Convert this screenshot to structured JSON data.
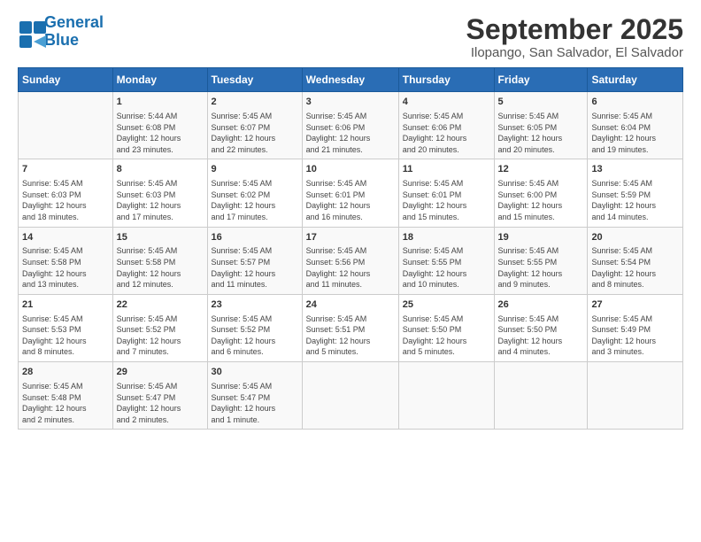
{
  "logo": {
    "line1": "General",
    "line2": "Blue"
  },
  "title": "September 2025",
  "subtitle": "Ilopango, San Salvador, El Salvador",
  "weekdays": [
    "Sunday",
    "Monday",
    "Tuesday",
    "Wednesday",
    "Thursday",
    "Friday",
    "Saturday"
  ],
  "weeks": [
    [
      {
        "day": "",
        "info": ""
      },
      {
        "day": "1",
        "info": "Sunrise: 5:44 AM\nSunset: 6:08 PM\nDaylight: 12 hours\nand 23 minutes."
      },
      {
        "day": "2",
        "info": "Sunrise: 5:45 AM\nSunset: 6:07 PM\nDaylight: 12 hours\nand 22 minutes."
      },
      {
        "day": "3",
        "info": "Sunrise: 5:45 AM\nSunset: 6:06 PM\nDaylight: 12 hours\nand 21 minutes."
      },
      {
        "day": "4",
        "info": "Sunrise: 5:45 AM\nSunset: 6:06 PM\nDaylight: 12 hours\nand 20 minutes."
      },
      {
        "day": "5",
        "info": "Sunrise: 5:45 AM\nSunset: 6:05 PM\nDaylight: 12 hours\nand 20 minutes."
      },
      {
        "day": "6",
        "info": "Sunrise: 5:45 AM\nSunset: 6:04 PM\nDaylight: 12 hours\nand 19 minutes."
      }
    ],
    [
      {
        "day": "7",
        "info": "Sunrise: 5:45 AM\nSunset: 6:03 PM\nDaylight: 12 hours\nand 18 minutes."
      },
      {
        "day": "8",
        "info": "Sunrise: 5:45 AM\nSunset: 6:03 PM\nDaylight: 12 hours\nand 17 minutes."
      },
      {
        "day": "9",
        "info": "Sunrise: 5:45 AM\nSunset: 6:02 PM\nDaylight: 12 hours\nand 17 minutes."
      },
      {
        "day": "10",
        "info": "Sunrise: 5:45 AM\nSunset: 6:01 PM\nDaylight: 12 hours\nand 16 minutes."
      },
      {
        "day": "11",
        "info": "Sunrise: 5:45 AM\nSunset: 6:01 PM\nDaylight: 12 hours\nand 15 minutes."
      },
      {
        "day": "12",
        "info": "Sunrise: 5:45 AM\nSunset: 6:00 PM\nDaylight: 12 hours\nand 15 minutes."
      },
      {
        "day": "13",
        "info": "Sunrise: 5:45 AM\nSunset: 5:59 PM\nDaylight: 12 hours\nand 14 minutes."
      }
    ],
    [
      {
        "day": "14",
        "info": "Sunrise: 5:45 AM\nSunset: 5:58 PM\nDaylight: 12 hours\nand 13 minutes."
      },
      {
        "day": "15",
        "info": "Sunrise: 5:45 AM\nSunset: 5:58 PM\nDaylight: 12 hours\nand 12 minutes."
      },
      {
        "day": "16",
        "info": "Sunrise: 5:45 AM\nSunset: 5:57 PM\nDaylight: 12 hours\nand 11 minutes."
      },
      {
        "day": "17",
        "info": "Sunrise: 5:45 AM\nSunset: 5:56 PM\nDaylight: 12 hours\nand 11 minutes."
      },
      {
        "day": "18",
        "info": "Sunrise: 5:45 AM\nSunset: 5:55 PM\nDaylight: 12 hours\nand 10 minutes."
      },
      {
        "day": "19",
        "info": "Sunrise: 5:45 AM\nSunset: 5:55 PM\nDaylight: 12 hours\nand 9 minutes."
      },
      {
        "day": "20",
        "info": "Sunrise: 5:45 AM\nSunset: 5:54 PM\nDaylight: 12 hours\nand 8 minutes."
      }
    ],
    [
      {
        "day": "21",
        "info": "Sunrise: 5:45 AM\nSunset: 5:53 PM\nDaylight: 12 hours\nand 8 minutes."
      },
      {
        "day": "22",
        "info": "Sunrise: 5:45 AM\nSunset: 5:52 PM\nDaylight: 12 hours\nand 7 minutes."
      },
      {
        "day": "23",
        "info": "Sunrise: 5:45 AM\nSunset: 5:52 PM\nDaylight: 12 hours\nand 6 minutes."
      },
      {
        "day": "24",
        "info": "Sunrise: 5:45 AM\nSunset: 5:51 PM\nDaylight: 12 hours\nand 5 minutes."
      },
      {
        "day": "25",
        "info": "Sunrise: 5:45 AM\nSunset: 5:50 PM\nDaylight: 12 hours\nand 5 minutes."
      },
      {
        "day": "26",
        "info": "Sunrise: 5:45 AM\nSunset: 5:50 PM\nDaylight: 12 hours\nand 4 minutes."
      },
      {
        "day": "27",
        "info": "Sunrise: 5:45 AM\nSunset: 5:49 PM\nDaylight: 12 hours\nand 3 minutes."
      }
    ],
    [
      {
        "day": "28",
        "info": "Sunrise: 5:45 AM\nSunset: 5:48 PM\nDaylight: 12 hours\nand 2 minutes."
      },
      {
        "day": "29",
        "info": "Sunrise: 5:45 AM\nSunset: 5:47 PM\nDaylight: 12 hours\nand 2 minutes."
      },
      {
        "day": "30",
        "info": "Sunrise: 5:45 AM\nSunset: 5:47 PM\nDaylight: 12 hours\nand 1 minute."
      },
      {
        "day": "",
        "info": ""
      },
      {
        "day": "",
        "info": ""
      },
      {
        "day": "",
        "info": ""
      },
      {
        "day": "",
        "info": ""
      }
    ]
  ]
}
